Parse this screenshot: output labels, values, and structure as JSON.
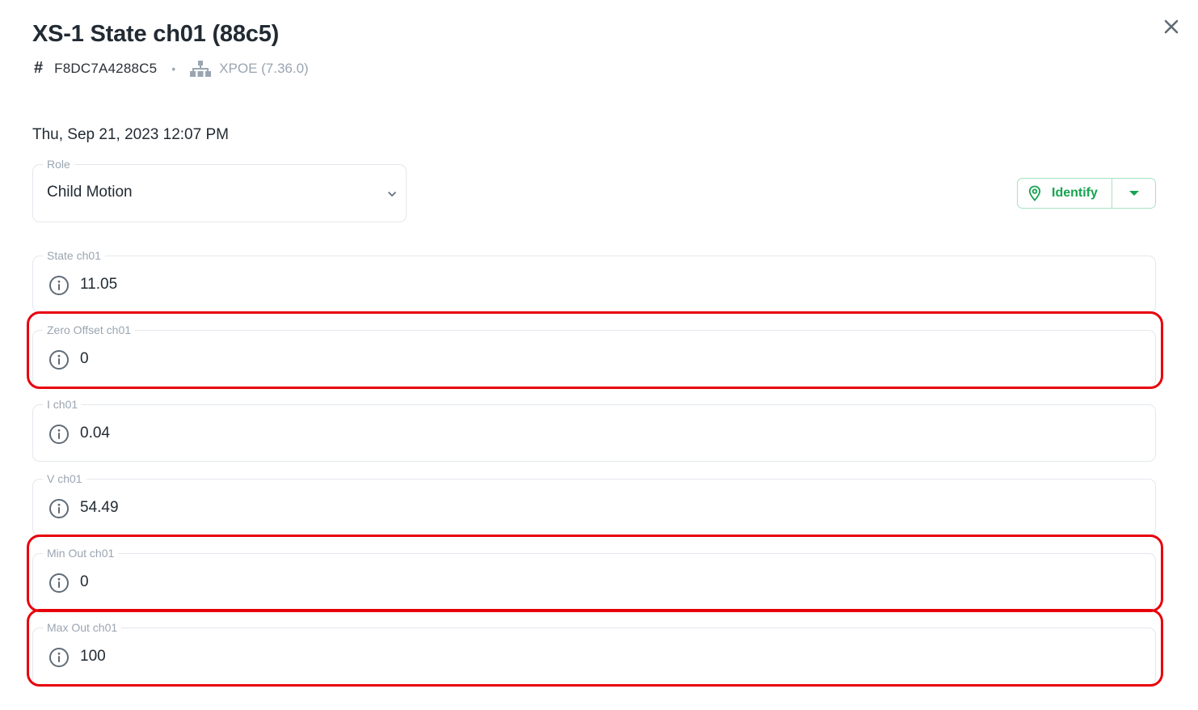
{
  "header": {
    "title": "XS-1 State ch01 (88c5)",
    "serial": "F8DC7A4288C5",
    "separator": "•",
    "firmware": "XPOE (7.36.0)",
    "hash_symbol": "#",
    "close_icon": "close-icon",
    "network_icon": "network-tree-icon"
  },
  "timestamp": "Thu, Sep 21, 2023 12:07 PM",
  "role": {
    "label": "Role",
    "value": "Child Motion"
  },
  "identify": {
    "label": "Identify",
    "icon": "map-pin-icon",
    "accent": "#17a350"
  },
  "fields": [
    {
      "label": "State ch01",
      "value": "11.05",
      "highlighted": false
    },
    {
      "label": "Zero Offset ch01",
      "value": "0",
      "highlighted": true
    },
    {
      "label": "I ch01",
      "value": "0.04",
      "highlighted": false
    },
    {
      "label": "V ch01",
      "value": "54.49",
      "highlighted": false
    },
    {
      "label": "Min Out ch01",
      "value": "0",
      "highlighted": true
    },
    {
      "label": "Max Out ch01",
      "value": "100",
      "highlighted": true
    }
  ],
  "highlight_color": "#e8000b"
}
